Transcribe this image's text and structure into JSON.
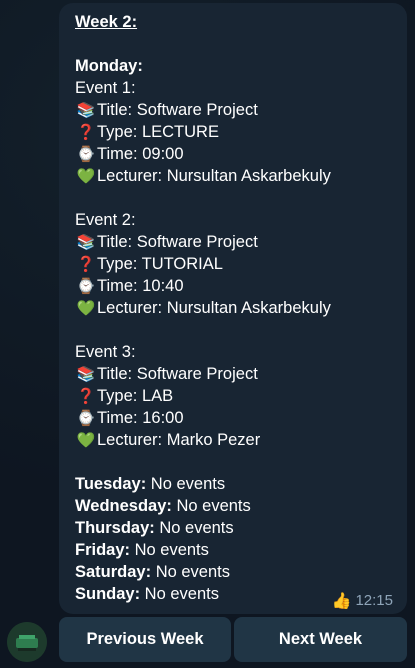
{
  "message": {
    "week_title": "Week 2:",
    "monday_label": "Monday:",
    "events": [
      {
        "heading": "Event 1:",
        "title": "Title: Software Project",
        "type": "Type: LECTURE",
        "time": "Time: 09:00",
        "lecturer": "Lecturer: Nursultan Askarbekuly"
      },
      {
        "heading": "Event 2:",
        "title": "Title: Software Project",
        "type": "Type: TUTORIAL",
        "time": "Time: 10:40",
        "lecturer": "Lecturer: Nursultan Askarbekuly"
      },
      {
        "heading": "Event 3:",
        "title": "Title: Software Project",
        "type": "Type: LAB",
        "time": "Time: 16:00",
        "lecturer": "Lecturer: Marko Pezer"
      }
    ],
    "icons": {
      "title": "📚",
      "type": "❓",
      "time": "⌚",
      "lecturer": "💚"
    },
    "other_days": [
      {
        "day": "Tuesday:",
        "status": " No events"
      },
      {
        "day": "Wednesday:",
        "status": " No events"
      },
      {
        "day": "Thursday:",
        "status": " No events"
      },
      {
        "day": "Friday:",
        "status": " No events"
      },
      {
        "day": "Saturday:",
        "status": " No events"
      },
      {
        "day": "Sunday:",
        "status": " No events"
      }
    ],
    "reaction": "👍",
    "timestamp": "12:15"
  },
  "buttons": {
    "previous": "Previous Week",
    "next": "Next Week"
  },
  "colors": {
    "background": "#0e1621",
    "bubble": "#182533",
    "button": "#203545",
    "meta_text": "#8ea4b8"
  }
}
